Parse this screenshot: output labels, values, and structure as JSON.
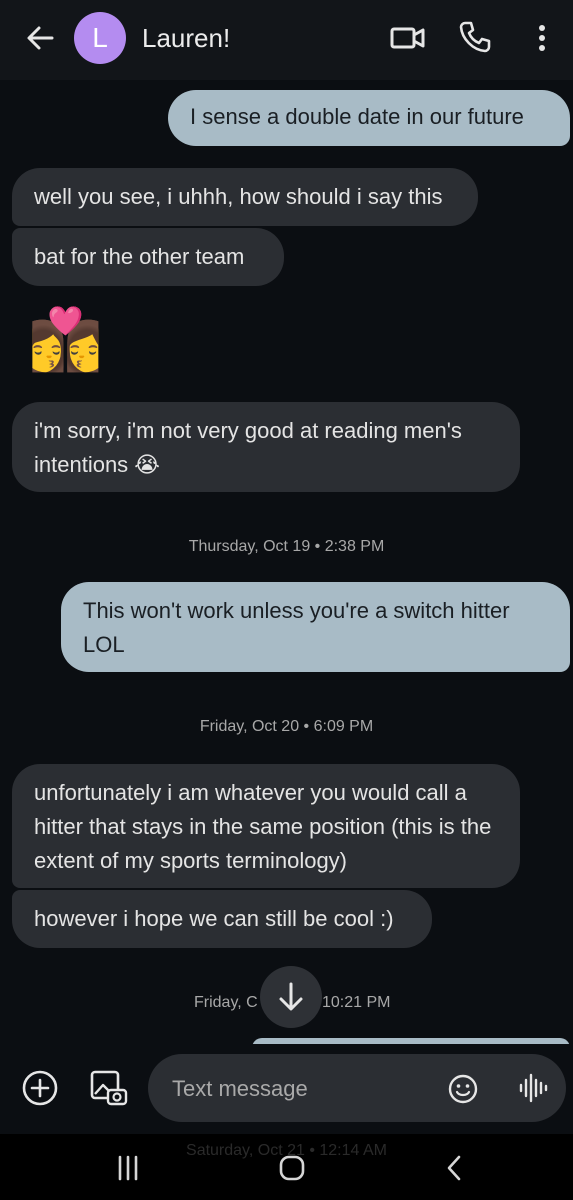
{
  "header": {
    "avatar_letter": "L",
    "contact_name": "Lauren!"
  },
  "messages": [
    {
      "direction": "outgoing",
      "text": "I sense a double date in our future"
    },
    {
      "direction": "incoming",
      "text": "well you see, i uhhh, how should i say this"
    },
    {
      "direction": "incoming",
      "text": "bat for the other team"
    },
    {
      "direction": "incoming",
      "text": "👩‍❤️‍💋‍👩"
    },
    {
      "direction": "incoming",
      "text": "i'm sorry, i'm not very good at reading men's intentions 😭"
    },
    {
      "direction": "timestamp",
      "text": "Thursday, Oct 19 • 2:38 PM"
    },
    {
      "direction": "outgoing",
      "text": "This won't work unless you're a switch hitter LOL"
    },
    {
      "direction": "timestamp",
      "text": "Friday, Oct 20 • 6:09 PM"
    },
    {
      "direction": "incoming",
      "text": "unfortunately i am whatever you would call a hitter that stays in the same position (this is the extent of my sports terminology)"
    },
    {
      "direction": "incoming",
      "text": "however i hope we can still be cool :)"
    },
    {
      "direction": "timestamp",
      "text": "Friday, Oct 20 • 10:21 PM",
      "partially_hidden": true
    }
  ],
  "timestamp_parts": {
    "left": "Friday, C",
    "right": "10:21 PM"
  },
  "composer": {
    "placeholder": "Text message"
  },
  "ghost_timestamp": "Saturday, Oct 21 • 12:14 AM",
  "colors": {
    "background": "#0b0e12",
    "incoming_bubble": "#2b2e33",
    "outgoing_bubble": "#a8bbc6",
    "avatar": "#b48cf0"
  },
  "icons": [
    "back-arrow-icon",
    "video-call-icon",
    "phone-icon",
    "more-vert-icon",
    "add-icon",
    "gallery-icon",
    "emoji-icon",
    "voice-icon",
    "scroll-down-icon",
    "recents-icon",
    "home-icon",
    "nav-back-icon"
  ]
}
